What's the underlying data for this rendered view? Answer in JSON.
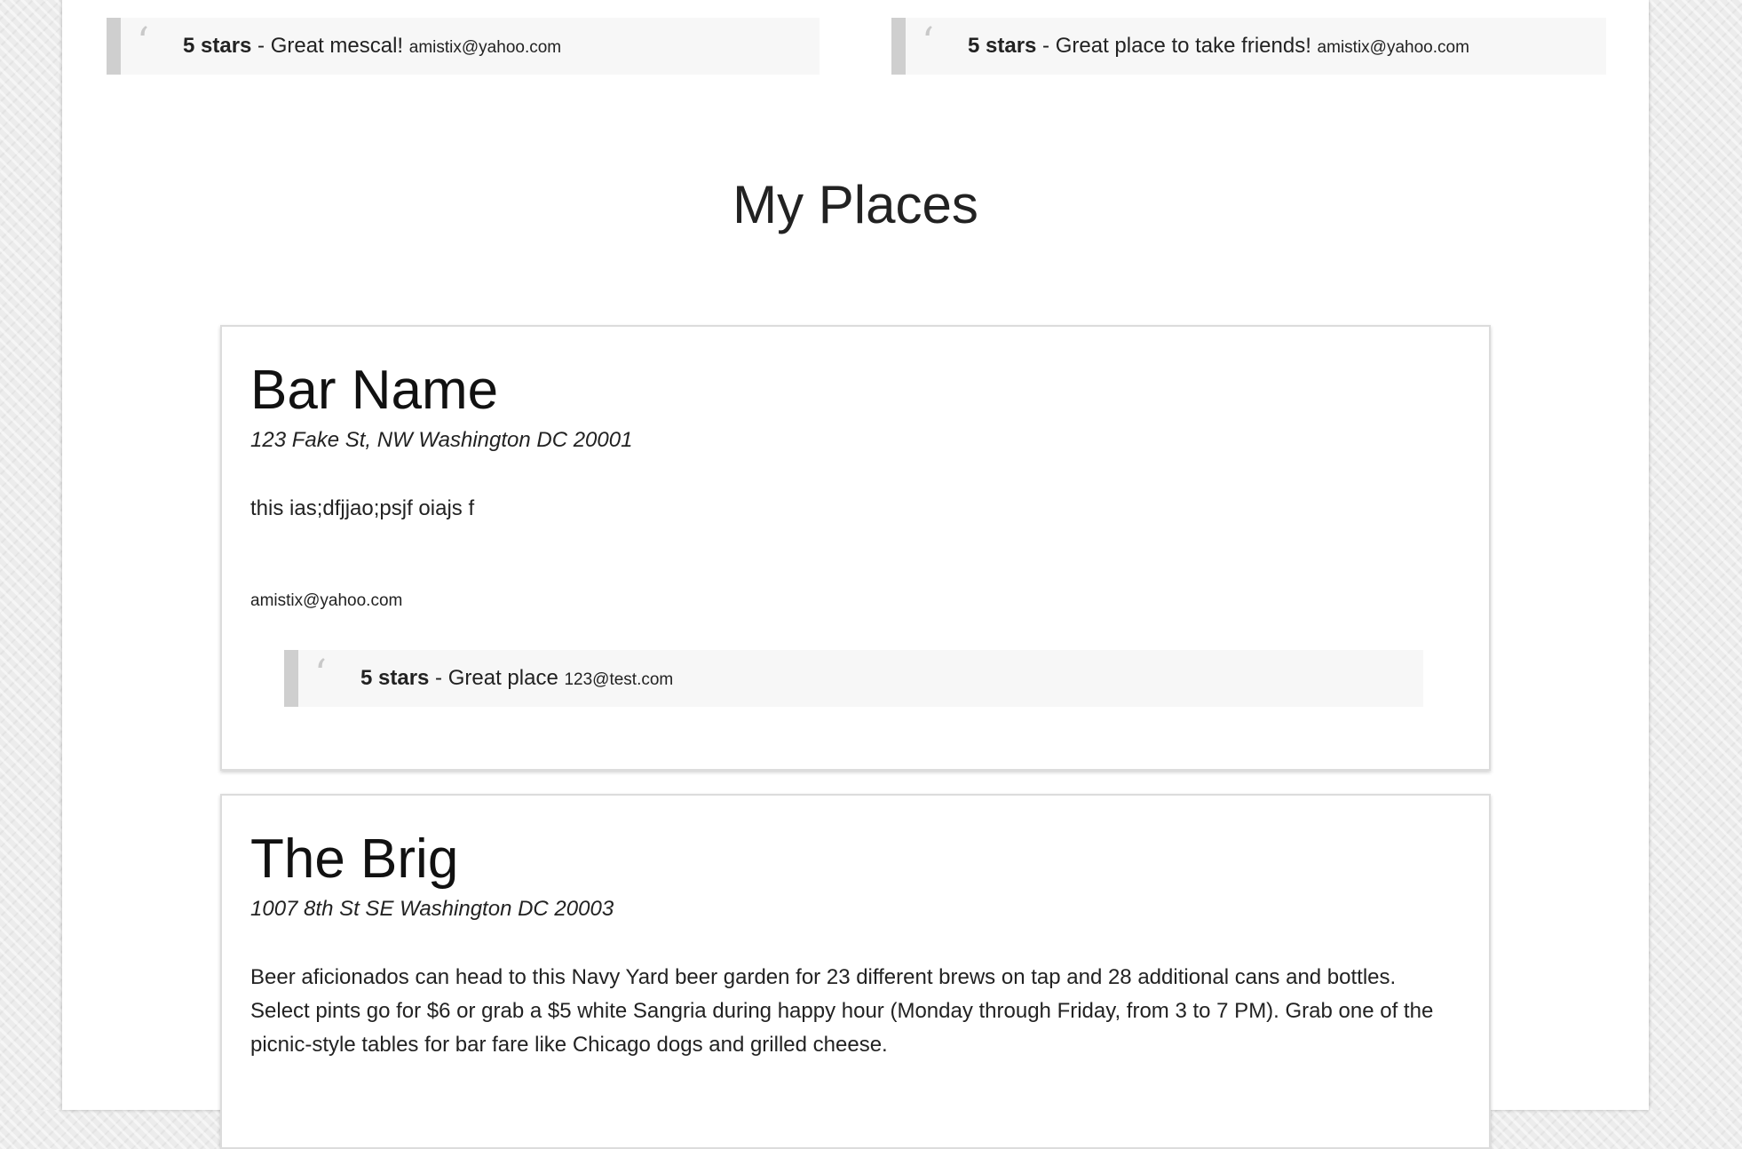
{
  "top_reviews": [
    {
      "stars": "5 stars",
      "separator": " - ",
      "comment": "Great mescal!",
      "email": "amistix@yahoo.com"
    },
    {
      "stars": "5 stars",
      "separator": " - ",
      "comment": "Great place to take friends!",
      "email": "amistix@yahoo.com"
    }
  ],
  "section": {
    "title": "My Places"
  },
  "places": [
    {
      "name": "Bar Name",
      "address": "123 Fake St, NW Washington DC 20001",
      "description": "this ias;dfjjao;psjf oiajs f",
      "owner_email": "amistix@yahoo.com",
      "review": {
        "stars": "5 stars",
        "separator": " - ",
        "comment": "Great place",
        "email": "123@test.com"
      }
    },
    {
      "name": "The Brig",
      "address": "1007 8th St SE Washington DC 20003",
      "description": "Beer aficionados can head to this Navy Yard beer garden for 23 different brews on tap and 28 additional cans and bottles. Select pints go for $6 or grab a $5 white Sangria during happy hour (Monday through Friday, from 3 to 7 PM). Grab one of the picnic-style tables for bar fare like Chicago dogs and grilled cheese."
    }
  ],
  "quote_glyph": "‘"
}
